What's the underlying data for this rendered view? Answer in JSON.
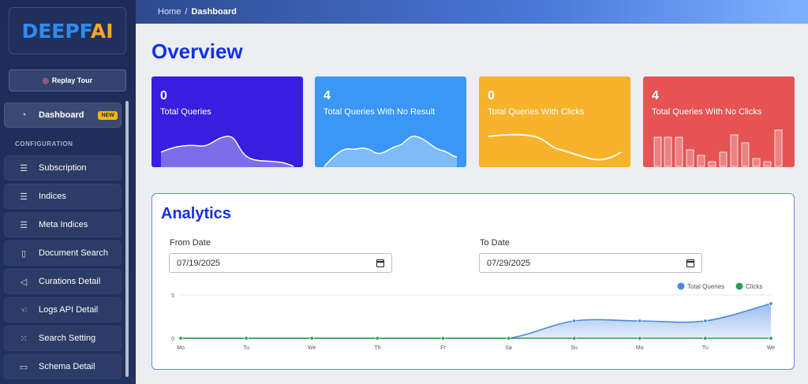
{
  "brand": {
    "logo_part1": "DEEP",
    "logo_part2": "F",
    "logo_part3": "AI"
  },
  "sidebar": {
    "replay_label": "Replay Tour",
    "section_label": "CONFIGURATION",
    "items": [
      {
        "label": "Dashboard",
        "icon": "gauge-icon",
        "badge": "NEW"
      },
      {
        "label": "Subscription",
        "icon": "list-icon"
      },
      {
        "label": "Indices",
        "icon": "list-icon"
      },
      {
        "label": "Meta Indices",
        "icon": "list-icon"
      },
      {
        "label": "Document Search",
        "icon": "document-icon"
      },
      {
        "label": "Curations Detail",
        "icon": "back-circle-icon"
      },
      {
        "label": "Logs API Detail",
        "icon": "hand-pointer-icon"
      },
      {
        "label": "Search Setting",
        "icon": "grid-dots-icon"
      },
      {
        "label": "Schema Detail",
        "icon": "monitor-icon"
      }
    ]
  },
  "breadcrumb": {
    "home": "Home",
    "separator": "/",
    "current": "Dashboard"
  },
  "page_title": "Overview",
  "cards": [
    {
      "value": "0",
      "label": "Total Queries",
      "color": "#3a1ee0"
    },
    {
      "value": "4",
      "label": "Total Queries With No Result",
      "color": "#3a97f5"
    },
    {
      "value": "0",
      "label": "Total Queries With Clicks",
      "color": "#f7b32b"
    },
    {
      "value": "4",
      "label": "Total Queries With No Clicks",
      "color": "#e55353"
    }
  ],
  "analytics": {
    "title": "Analytics",
    "from_label": "From Date",
    "from_value": "07/19/2025",
    "to_label": "To Date",
    "to_value": "07/29/2025"
  },
  "chart_data": {
    "type": "area",
    "categories": [
      "Mo",
      "Tu",
      "We",
      "Th",
      "Fr",
      "Sa",
      "Su",
      "Mo",
      "Tu",
      "We"
    ],
    "series": [
      {
        "name": "Total Queries",
        "color": "#4a8ae0",
        "values": [
          0,
          0,
          0,
          0,
          0,
          0,
          2,
          2,
          2,
          4
        ]
      },
      {
        "name": "Clicks",
        "color": "#2aa04a",
        "values": [
          0,
          0,
          0,
          0,
          0,
          0,
          0,
          0,
          0,
          0
        ]
      }
    ],
    "yticks": [
      "5",
      "0"
    ],
    "ylim": [
      0,
      5
    ],
    "legend": "top-right"
  }
}
